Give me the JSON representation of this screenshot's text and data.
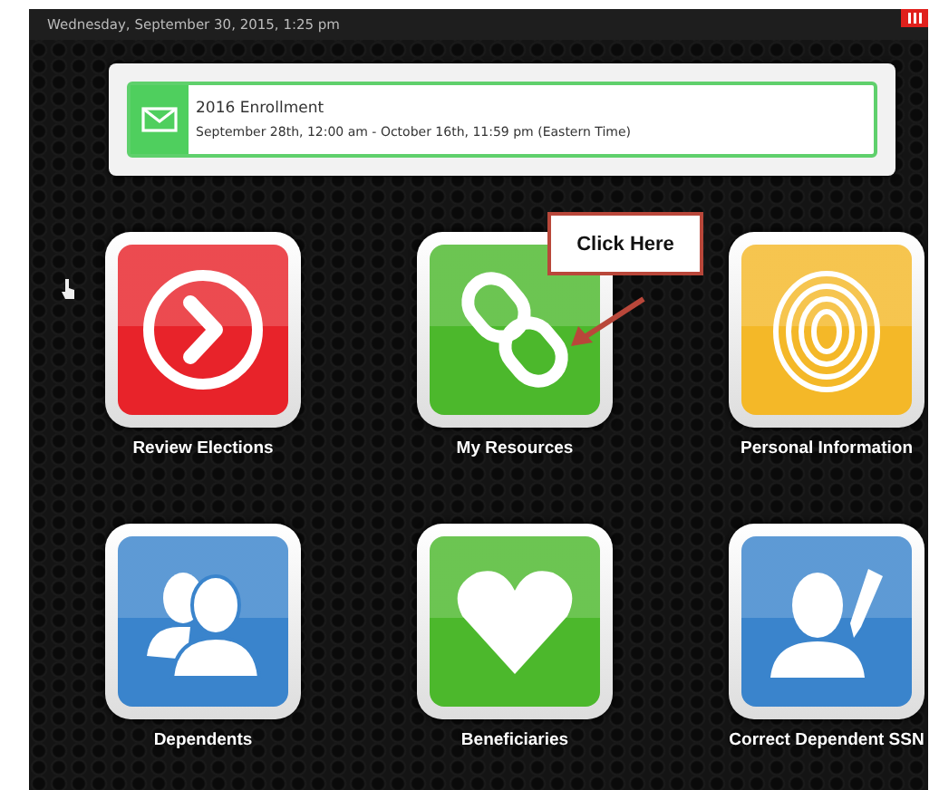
{
  "top_bar": {
    "date": "Wednesday, September 30, 2015, 1:25 pm"
  },
  "notice": {
    "title": "2016 Enrollment",
    "period": "September 28th, 12:00 am - October 16th, 11:59 pm (Eastern Time)"
  },
  "tiles": [
    {
      "label": "Review Elections",
      "kind": "arrow-circle",
      "color": "#e8232a"
    },
    {
      "label": "My Resources",
      "kind": "chain",
      "color": "#4cb82c"
    },
    {
      "label": "Personal Information",
      "kind": "fingerprint",
      "color": "#f4b828"
    },
    {
      "label": "Dependents",
      "kind": "people",
      "color": "#3a84cc"
    },
    {
      "label": "Beneficiaries",
      "kind": "heart",
      "color": "#4cb82c"
    },
    {
      "label": "Correct Dependent SSN",
      "kind": "person-edit",
      "color": "#3a84cc"
    }
  ],
  "callout": {
    "text": "Click Here"
  }
}
